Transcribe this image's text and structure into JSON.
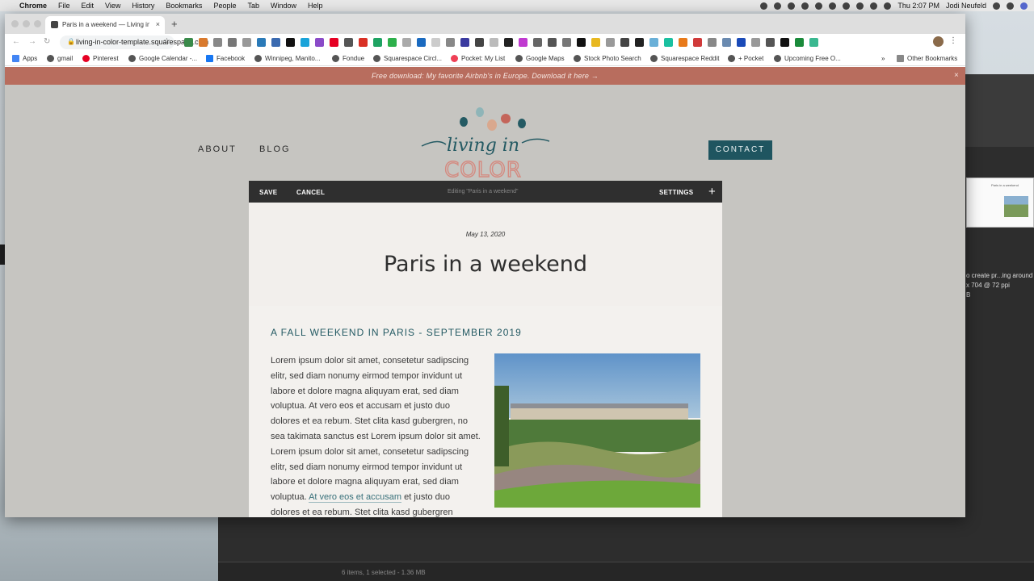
{
  "menubar": {
    "app": "Chrome",
    "items": [
      "File",
      "Edit",
      "View",
      "History",
      "Bookmarks",
      "People",
      "Tab",
      "Window",
      "Help"
    ],
    "clock": "Thu 2:07 PM",
    "user": "Jodi Neufeld"
  },
  "tab": {
    "title": "Paris in a weekend — Living in Color",
    "close": "×"
  },
  "omnibox": {
    "url": "living-in-color-template.squarespace.com"
  },
  "bookmarks": {
    "items": [
      {
        "label": "Apps",
        "color": "#4285f4"
      },
      {
        "label": "gmail",
        "color": "#555555"
      },
      {
        "label": "Pinterest",
        "color": "#e60023"
      },
      {
        "label": "Google Calendar -...",
        "color": "#555555"
      },
      {
        "label": "Facebook",
        "color": "#1877f2"
      },
      {
        "label": "Winnipeg, Manito...",
        "color": "#555555"
      },
      {
        "label": "Fondue",
        "color": "#555555"
      },
      {
        "label": "Squarespace Circl...",
        "color": "#555555"
      },
      {
        "label": "Pocket: My List",
        "color": "#ef4056"
      },
      {
        "label": "Google Maps",
        "color": "#555555"
      },
      {
        "label": "Stock Photo Search",
        "color": "#555555"
      },
      {
        "label": "Squarespace Reddit",
        "color": "#555555"
      },
      {
        "label": "+ Pocket",
        "color": "#555555"
      },
      {
        "label": "Upcoming Free O...",
        "color": "#555555"
      }
    ],
    "overflow": "»",
    "other": "Other Bookmarks"
  },
  "site": {
    "banner": "Free download: My favorite Airbnb's in Europe. Download it here →",
    "banner_close": "×",
    "nav": {
      "about": "ABOUT",
      "blog": "BLOG",
      "contact": "CONTACT"
    },
    "logo": {
      "script": "living in",
      "block": "COLOR"
    }
  },
  "editor": {
    "save": "SAVE",
    "cancel": "CANCEL",
    "status": "Editing \"Paris in a weekend\"",
    "settings": "SETTINGS",
    "add": "+"
  },
  "post": {
    "date": "May 13, 2020",
    "title": "Paris in a weekend",
    "section_heading": "A FALL WEEKEND IN PARIS - SEPTEMBER 2019",
    "paragraph_before_link": "Lorem ipsum dolor sit amet, consetetur sadipscing elitr, sed diam nonumy eirmod tempor invidunt ut labore et dolore magna aliquyam erat, sed diam voluptua. At vero eos et accusam et justo duo dolores et ea rebum. Stet clita kasd gubergren, no sea takimata sanctus est Lorem ipsum dolor sit amet. Lorem ipsum dolor sit amet, consetetur sadipscing elitr, sed diam nonumy eirmod tempor invidunt ut labore et dolore magna aliquyam erat, sed diam voluptua. ",
    "paragraph_link": "At vero eos et accusam",
    "paragraph_after_link": " et justo duo dolores et ea rebum. Stet clita kasd gubergren"
  },
  "background": {
    "thumb_title": "Paris in a weekend",
    "info_line1": "o create pr...ing around i",
    "info_line2": "x 704 @ 72 ppi",
    "info_line3": "B",
    "status": "6 items, 1 selected - 1.36 MB"
  },
  "colors": {
    "banner": "#b86d5e",
    "site_bg": "#c6c5c1",
    "contact": "#1f5560",
    "editor_bar": "#2f2f2f",
    "heading": "#245a63"
  }
}
